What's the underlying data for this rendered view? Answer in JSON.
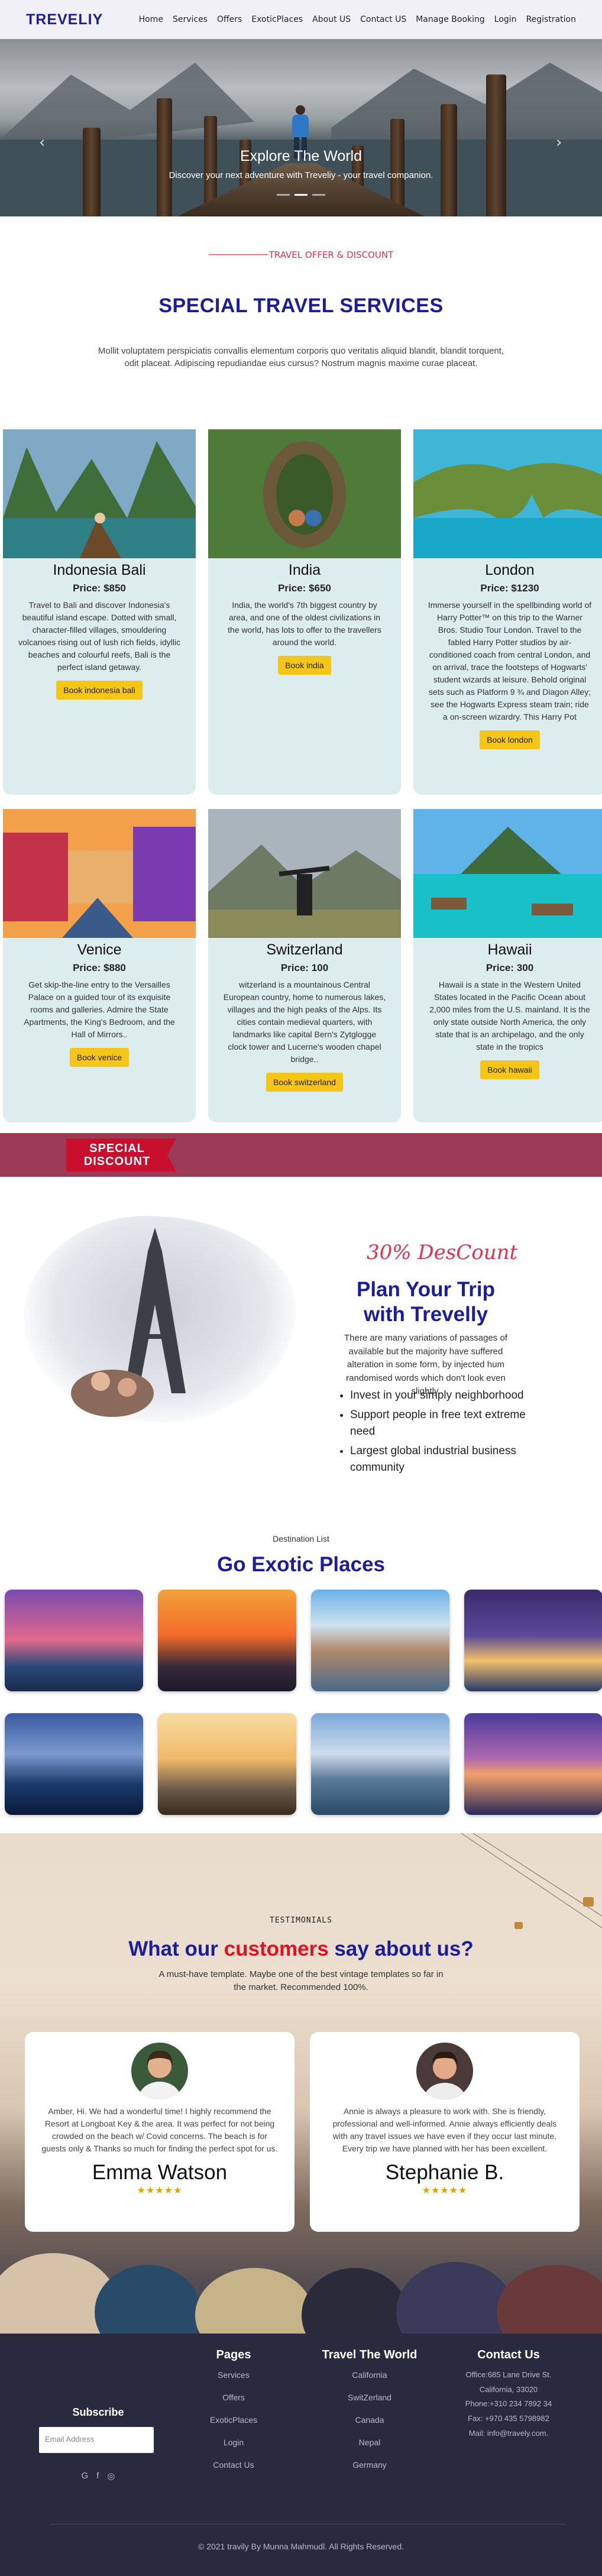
{
  "nav": {
    "brand": "TREVELIY",
    "items": [
      "Home",
      "Services",
      "Offers",
      "ExoticPlaces",
      "About US",
      "Contact US",
      "Manage Booking",
      "Login",
      "Registration"
    ]
  },
  "hero": {
    "title": "Explore The World",
    "subtitle": "Discover your next adventure with Treveliy - your travel companion.",
    "prev_icon": "chevron-left-icon",
    "next_icon": "chevron-right-icon"
  },
  "services": {
    "kicker": "TRAVEL OFFER & DISCOUNT",
    "title": "SPECIAL TRAVEL SERVICES",
    "lead": "Mollit voluptatem perspiciatis convallis elementum corporis quo veritatis aliquid blandit, blandit torquent, odit placeat. Adipiscing repudiandae eius cursus? Nostrum magnis maxime curae placeat.",
    "cards": [
      {
        "name": "Indonesia Bali",
        "price": "Price: $850",
        "text": "Travel to Bali and discover Indonesia's beautiful island escape. Dotted with small, character-filled villages, smouldering volcanoes rising out of lush rich fields, idyllic beaches and colourful reefs, Bali is the perfect island getaway.",
        "button": "Book indonesia bali"
      },
      {
        "name": "India",
        "price": "Price: $650",
        "text": "India, the world's 7th biggest country by area, and one of the oldest civilizations in the world, has lots to offer to the travellers around the world.",
        "button": "Book india"
      },
      {
        "name": "London",
        "price": "Price: $1230",
        "text": "Immerse yourself in the spellbinding world of Harry Potter™ on this trip to the Warner Bros. Studio Tour London. Travel to the fabled Harry Potter studios by air-conditioned coach from central London, and on arrival, trace the footsteps of Hogwarts' student wizards at leisure. Behold original sets such as Platform 9 ¾ and Diagon Alley; see the Hogwarts Express steam train; ride a on-screen wizardry. This Harry Pot",
        "button": "Book london"
      },
      {
        "name": "Venice",
        "price": "Price: $880",
        "text": "Get skip-the-line entry to the Versailles Palace on a guided tour of its exquisite rooms and galleries. Admire the State Apartments, the King's Bedroom, and the Hall of Mirrors..",
        "button": "Book venice"
      },
      {
        "name": "Switzerland",
        "price": "Price: 100",
        "text": "witzerland is a mountainous Central European country, home to numerous lakes, villages and the high peaks of the Alps. Its cities contain medieval quarters, with landmarks like capital Bern's Zytglogge clock tower and Lucerne's wooden chapel bridge..",
        "button": "Book switzerland"
      },
      {
        "name": "Hawaii",
        "price": "Price: 300",
        "text": "Hawaii is a state in the Western United States located in the Pacific Ocean about 2,000 miles from the U.S. mainland. It is the only state outside North America, the only state that is an archipelago, and the only state in the tropics",
        "button": "Book hawaii"
      }
    ]
  },
  "strip": {
    "ribbon": [
      "SPECIAL",
      "DISCOUNT"
    ]
  },
  "plan": {
    "discount": "30% DesCount",
    "title": "Plan Your Trip with Trevelly",
    "text": "There are many variations of passages of available but the majority have suffered alteration in some form, by injected hum randomised words which don't look even slightly.",
    "bullets": [
      "Invest in your simply neighborhood",
      "Support people in free text extreme need",
      "Largest global industrial business community"
    ]
  },
  "destinations": {
    "small": "Destination List",
    "title": "Go Exotic Places"
  },
  "testimonials": {
    "kicker": "TESTIMONIALS",
    "title_a": "What our ",
    "title_b": "customers",
    "title_c": " say about us?",
    "lead": "A must-have template. Maybe one of the best vintage templates so far in the market. Recommended 100%.",
    "reviews": [
      {
        "text": "Amber, Hi. We had a wonderful time! I highly recommend the Resort at Longboat Key & the area. It was perfect for not being crowded on the beach w/ Covid concerns. The beach is for guests only & Thanks so much for finding the perfect spot for us.",
        "name": "Emma Watson",
        "stars": "★★★★★"
      },
      {
        "text": "Annie is always a pleasure to work with. She is friendly, professional and well-informed. Annie always efficiently deals with any travel issues we have even if they occur last minute. Every trip we have planned with her has been excellent.",
        "name": "Stephanie B.",
        "stars": "★★★★★"
      }
    ]
  },
  "footer": {
    "subscribe": {
      "title": "Subscribe",
      "placeholder": "Email Address"
    },
    "pages": {
      "title": "Pages",
      "links": [
        "Services",
        "Offers",
        "ExoticPlaces",
        "Login",
        "Contact Us"
      ]
    },
    "travel": {
      "title": "Travel The World",
      "links": [
        "California",
        "SwitZerland",
        "Canada",
        "Nepal",
        "Germany"
      ]
    },
    "contact": {
      "title": "Contact Us",
      "lines": [
        "Office:685 Lane Drive St.",
        "California, 33020",
        "Phone:+310 234 7892 34",
        "Fax: +970 435 5798982",
        "Mail: info@travely.com."
      ]
    },
    "social_icons": [
      "google-icon",
      "facebook-icon",
      "instagram-icon"
    ],
    "copyright": "© 2021 travily By Munna Mahmudl. All Rights Reserved."
  }
}
